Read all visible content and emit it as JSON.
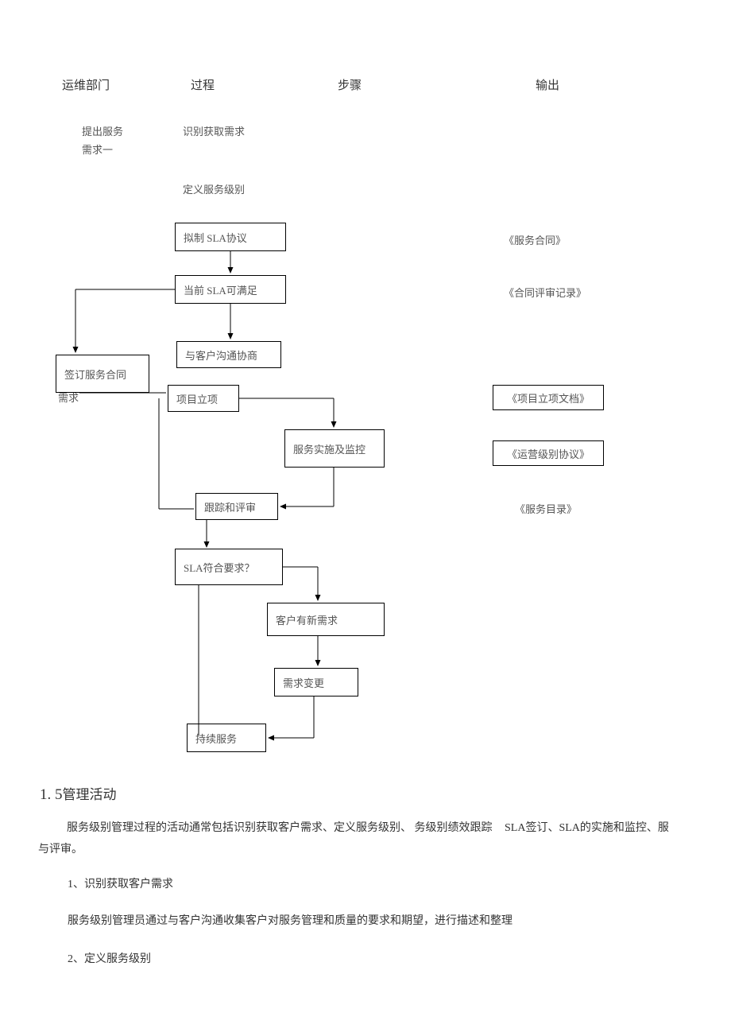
{
  "headers": {
    "col1": "运维部门",
    "col2": "过程",
    "col3": "步骤",
    "col4": "输出"
  },
  "lane1": {
    "submit_service": "提出服务",
    "demand_one": "需求一",
    "sign_contract": "签订服务合同",
    "demand": "需求"
  },
  "process_steps": {
    "identify": "识别获取需求",
    "define_level": "定义服务级别",
    "draft_sla": "拟制  SLA协议",
    "sla_satisfy": "当前  SLA可满足",
    "communicate": "与客户沟通协商",
    "project_init": "项目立项",
    "implement_monitor": "服务实施及监控",
    "track_review": "跟踪和评审",
    "sla_meets": "SLA符合要求？",
    "new_demand": "客户有新需求",
    "demand_change": "需求变更",
    "continue_service": "持续服务"
  },
  "outputs": {
    "service_contract": "《服务合同》",
    "contract_review": "《合同评审记录》",
    "project_doc": "《项目立项文档》",
    "ops_level": "《运营级别协议》",
    "service_catalog": "《服务目录》"
  },
  "section": {
    "title_num": "1. 5",
    "title_text": "管理活动",
    "para1_a": "服务级别管理过程的活动通常包括识别获取客户需求、定义服务级别、 务级别绩效跟踪",
    "para1_b": "SLA签订、SLA的实施和监控、服",
    "para1_c": "与评审。",
    "item1": "1、识别获取客户需求",
    "item1_desc": "服务级别管理员通过与客户沟通收集客户对服务管理和质量的要求和期望，进行描述和整理",
    "item2": "2、定义服务级别"
  }
}
